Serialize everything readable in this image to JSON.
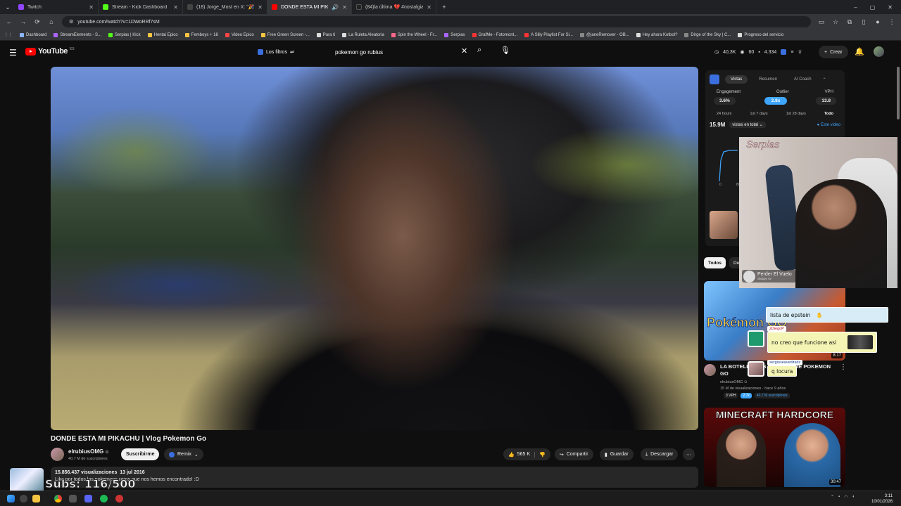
{
  "browser": {
    "tabs": [
      {
        "label": "Twitch",
        "color": "#9146ff",
        "active": false
      },
      {
        "label": "Stream - Kick Dashboard",
        "color": "#53fc18",
        "active": false
      },
      {
        "label": "(18) Jorge_Most en X: \"🎉 CCU",
        "color": "#444444",
        "active": false
      },
      {
        "label": "DONDE ESTA MI PIKACHU",
        "color": "#ff0000",
        "active": true
      },
      {
        "label": "(84)la última 💔 #nostalgia #f",
        "color": "#222222",
        "active": false
      }
    ],
    "url": "youtube.com/watch?v=1DWoRRf7sM",
    "bookmarks": [
      "Dashboard",
      "StreamElements - S...",
      "Serpias | Kick",
      "Hentai Epico",
      "Femboys + 18",
      "Video Epico",
      "Free Green Screen -...",
      "Para ti",
      "La Ruleta Aleatoria",
      "Spin the Wheel - Fr...",
      "Serpias",
      "GrafMe - Fotomont...",
      "A Silly Playlist For Si...",
      "@janeRemover - OB...",
      "Hey ahora Kotbol?",
      "Dirge of the Sky | C...",
      "Progreso del servicio"
    ]
  },
  "header": {
    "logo": "YouTube",
    "logo_cc": "ES",
    "filters_label": "Los filtros",
    "search_value": "pokemon go rubius",
    "stats": [
      "40,3K",
      "60",
      "4.334"
    ],
    "create_label": "Crear"
  },
  "video": {
    "title": "DONDE ESTA MI PIKACHU | Vlog Pokemon Go",
    "channel": "elrubiusOMG",
    "subs": "40,7 M de suscriptores",
    "subscribe_label": "Suscribirme",
    "remix_label": "Remix",
    "likes": "565 K",
    "share_label": "Compartir",
    "save_label": "Guardar",
    "download_label": "Descargar",
    "views": "15.856.437 visualizaciones",
    "date": "13 jul 2016",
    "description": "Like por todos los pokemons raros que nos hemos encontrado! :D"
  },
  "stats_panel": {
    "tabs": [
      "Vistas",
      "Resumen",
      "AI Coach"
    ],
    "metric_labels": [
      "Engagement",
      "Outlier",
      "VPH"
    ],
    "metric_values": [
      "3.6%",
      "2.8x",
      "13.8"
    ],
    "ranges": [
      "24 hours",
      "1st 7 days",
      "1st 28 days",
      "Todo"
    ],
    "total_value": "15.9M",
    "total_label": "vistas en total",
    "scope_label": "Este video",
    "axis": [
      "0",
      "8/1"
    ]
  },
  "chips": [
    "Todos",
    "De"
  ],
  "recs": [
    {
      "title": "LA BOTELLA MÁS EXTRAÑA DE POKEMON GO",
      "thumb_text": "Pokémon GO",
      "channel": "elrubiusOMG",
      "meta": "15 M de visualizaciones · hace 9 años",
      "tags": [
        "3 VPH",
        "2.7x",
        "40,7 M suscriptores"
      ],
      "duration": "8:17"
    },
    {
      "title": "MINECRAFT HARDCORE",
      "thumb_text": "MINECRAFT HARDCORE",
      "duration": "30:47"
    }
  ],
  "overlay": {
    "webcam_sign": "Serpias",
    "song_title": "Perder El Vuelo",
    "song_sub": "Sloppy Av",
    "chat": [
      {
        "user": "",
        "text": "lista de epstein"
      },
      {
        "user": "zDiegoP",
        "text": "no creo que funcione asi"
      },
      {
        "user": "sergioseaveditadz",
        "text": "q locura"
      }
    ],
    "subs_text": "Subs: 116/500"
  },
  "taskbar": {
    "time": "3:11",
    "date": "10/01/2026"
  }
}
